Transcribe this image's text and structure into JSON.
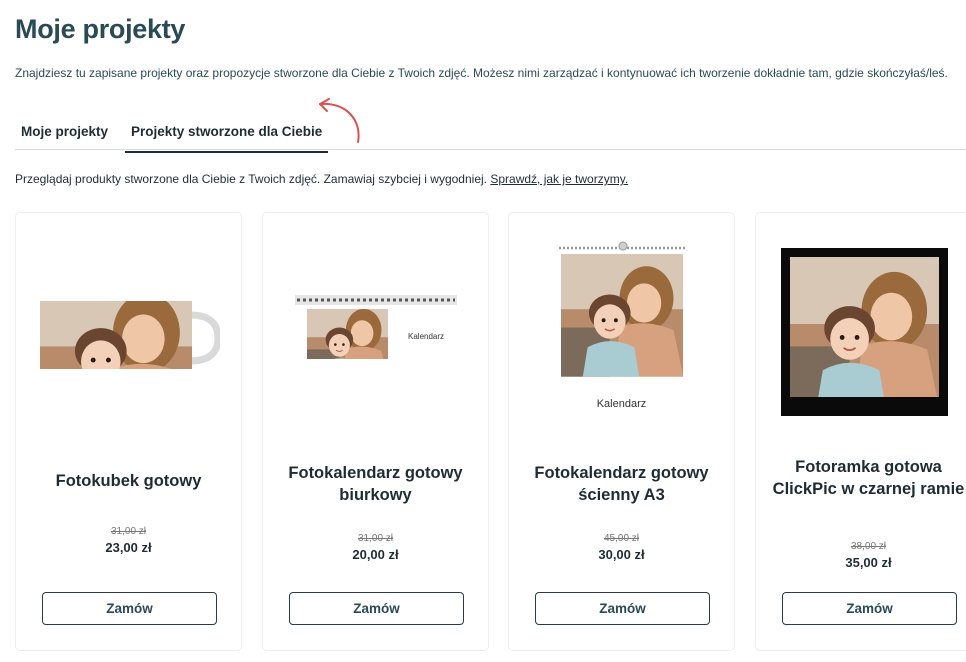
{
  "header": {
    "title": "Moje projekty",
    "intro": "Znajdziesz tu zapisane projekty oraz propozycje stworzone dla Ciebie z Twoich zdjęć. Możesz nimi zarządzać i kontynuować ich tworzenie dokładnie tam, gdzie skończyłaś/leś."
  },
  "tabs": [
    {
      "label": "Moje projekty",
      "active": false
    },
    {
      "label": "Projekty stworzone dla Ciebie",
      "active": true
    }
  ],
  "subintro": {
    "text": "Przeglądaj produkty stworzone dla Ciebie z Twoich zdjęć. Zamawiaj szybciej i wygodniej. ",
    "link": "Sprawdź, jak je tworzymy."
  },
  "products": [
    {
      "name": "Fotokubek gotowy",
      "old_price": "31,00 zł",
      "price": "23,00 zł",
      "button": "Zamów"
    },
    {
      "name": "Fotokalendarz gotowy biurkowy",
      "old_price": "31,00 zł",
      "price": "20,00 zł",
      "button": "Zamów",
      "image_label": "Kalendarz"
    },
    {
      "name": "Fotokalendarz gotowy ścienny A3",
      "old_price": "45,00 zł",
      "price": "30,00 zł",
      "button": "Zamów",
      "image_label": "Kalendarz"
    },
    {
      "name": "Fotoramka gotowa ClickPic w czarnej ramie",
      "old_price": "38,00 zł",
      "price": "35,00 zł",
      "button": "Zamów"
    }
  ],
  "colors": {
    "accent": "#2a4a55",
    "arrow": "#d9534f"
  }
}
